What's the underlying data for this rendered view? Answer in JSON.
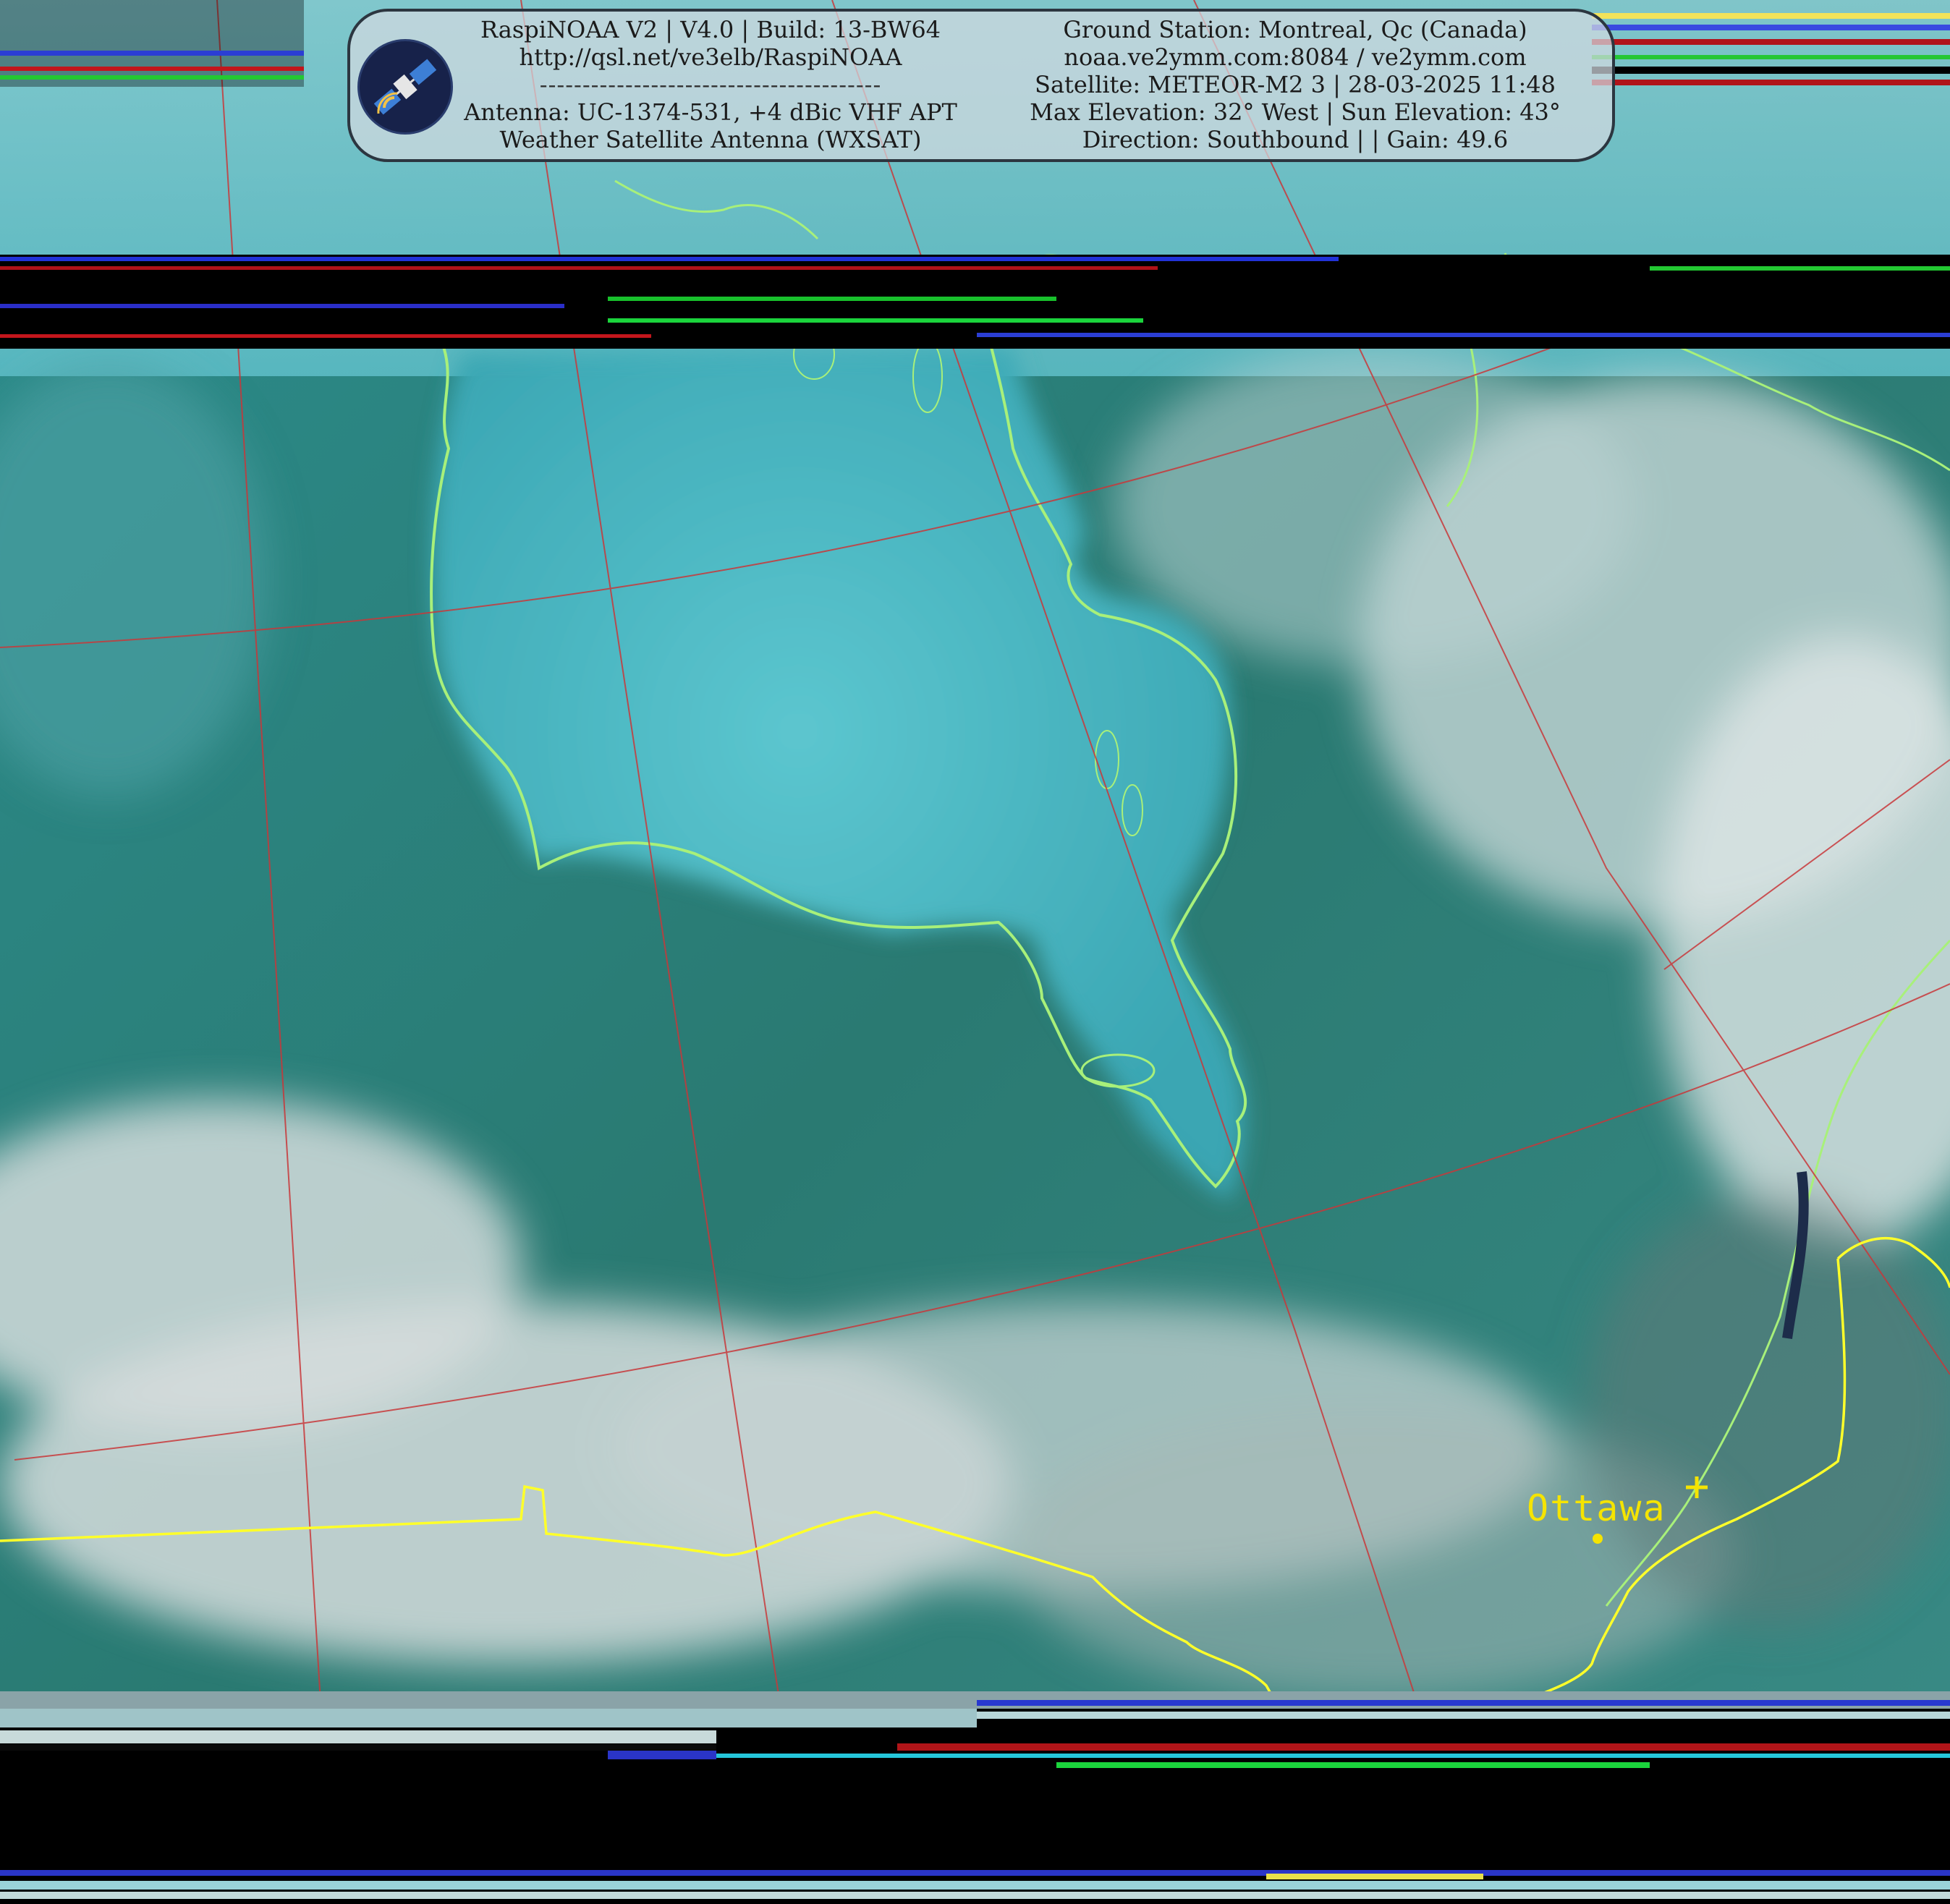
{
  "header": {
    "left_lines": [
      "RaspiNOAA V2 | V4.0 | Build: 13-BW64",
      "http://qsl.net/ve3elb/RaspiNOAA",
      "----------------------------------------",
      "Antenna: UC-1374-531, +4 dBic VHF APT",
      "Weather Satellite Antenna (WXSAT)"
    ],
    "right_lines": [
      "Ground Station: Montreal, Qc (Canada)",
      "noaa.ve2ymm.com:8084 / ve2ymm.com",
      "Satellite: METEOR-M2 3 | 28-03-2025 11:48",
      "Max Elevation: 32° West | Sun Elevation: 43°",
      "Direction: Southbound | | Gain: 49.6"
    ],
    "logo_icon": "satellite-icon"
  },
  "map": {
    "city_label": "Ottawa",
    "coastline_color": "#a8f07a",
    "border_color": "#ffff2a",
    "graticule_color": "#c8383a",
    "water_color": "#3fb0bd",
    "land_color": "#2f7f7a",
    "cloud_color": "#d8dede"
  }
}
